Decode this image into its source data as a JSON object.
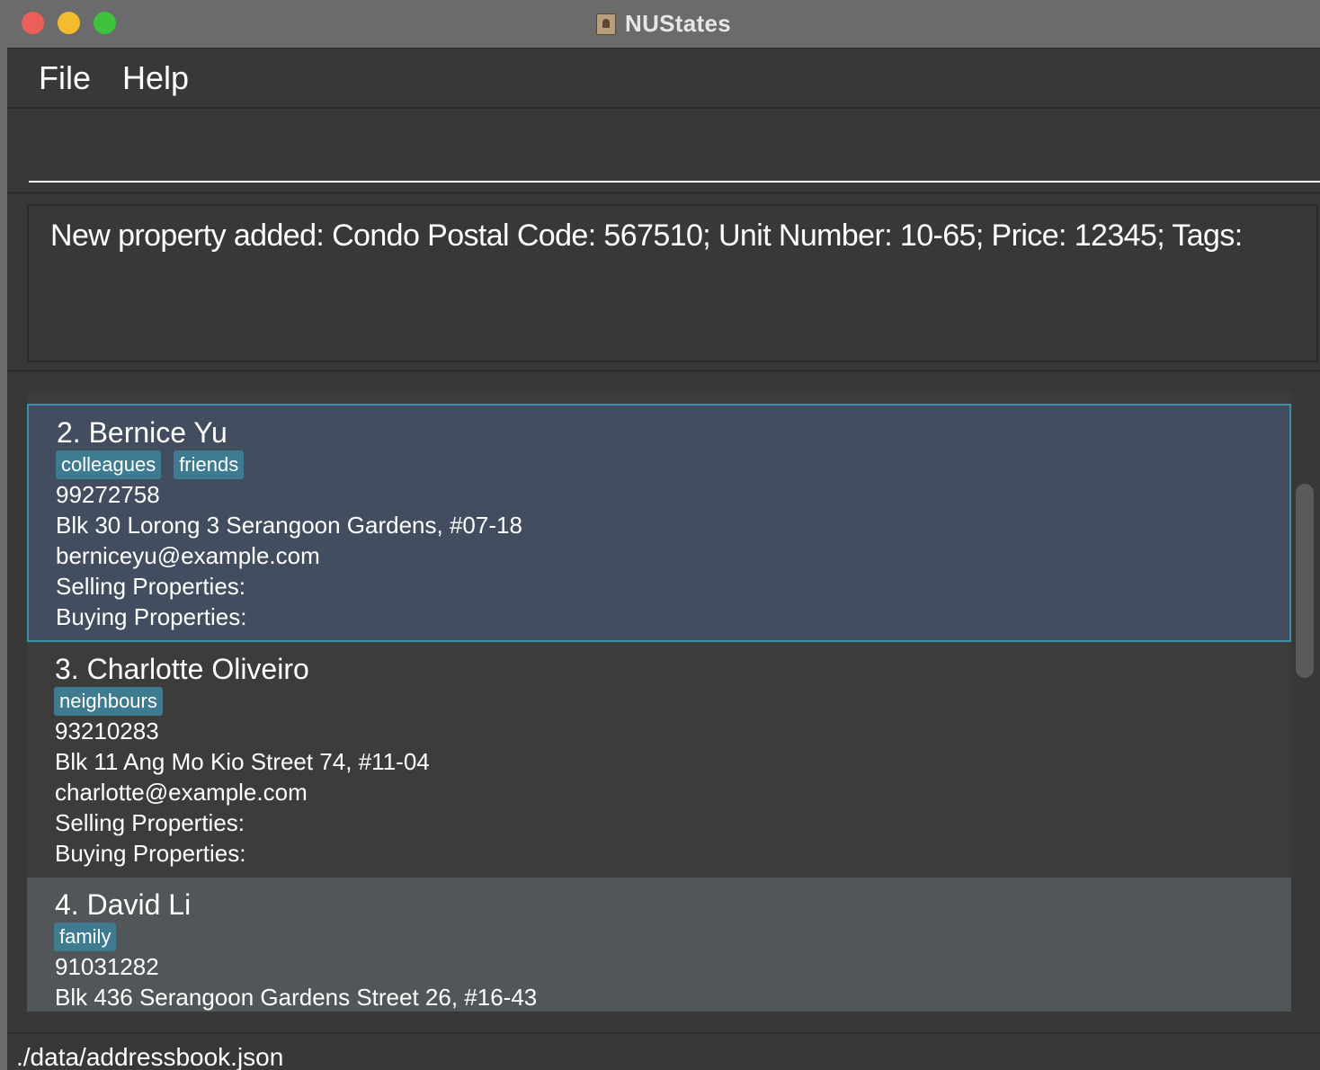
{
  "window": {
    "title": "NUStates",
    "app_icon": "address-book-icon"
  },
  "menu": {
    "file": "File",
    "help": "Help"
  },
  "command": {
    "value": "",
    "placeholder": ""
  },
  "result": {
    "text": "New property added: Condo Postal Code: 567510;  Unit Number: 10-65;  Price: 12345; Tags:"
  },
  "persons": [
    {
      "name": "2. Bernice Yu",
      "tags": [
        "colleagues",
        "friends"
      ],
      "phone": "99272758",
      "address": "Blk 30 Lorong 3 Serangoon Gardens, #07-18",
      "email": "berniceyu@example.com",
      "selling": "Selling Properties:",
      "buying": "Buying Properties:"
    },
    {
      "name": "3. Charlotte Oliveiro",
      "tags": [
        "neighbours"
      ],
      "phone": "93210283",
      "address": "Blk 11 Ang Mo Kio Street 74, #11-04",
      "email": "charlotte@example.com",
      "selling": "Selling Properties:",
      "buying": "Buying Properties:"
    },
    {
      "name": "4. David Li",
      "tags": [
        "family"
      ],
      "phone": "91031282",
      "address": "Blk 436 Serangoon Gardens Street 26, #16-43"
    }
  ],
  "status": {
    "path": "./data/addressbook.json"
  },
  "colors": {
    "tag": "#3e7b91",
    "selected_border": "#3d8fa7",
    "selected_bg": "#424d5f"
  }
}
